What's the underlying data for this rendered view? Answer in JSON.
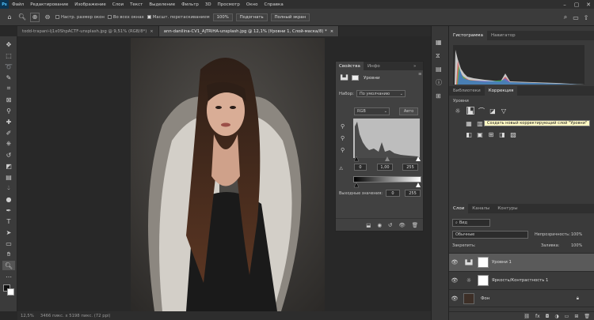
{
  "app": {
    "logo": "Ps"
  },
  "menu": [
    "Файл",
    "Редактирование",
    "Изображение",
    "Слои",
    "Текст",
    "Выделение",
    "Фильтр",
    "3D",
    "Просмотр",
    "Окно",
    "Справка"
  ],
  "options": {
    "resize_windows": "Настр. размер окон",
    "all_windows": "Во всех окнах",
    "scrubby_zoom": "Масшт. перетаскиванием",
    "zoom_value": "100%",
    "fit_button": "Подогнать",
    "fill_screen_button": "Полный экран"
  },
  "tabs": [
    {
      "label": "todd-trapani-Ij1x0ShpACTF-unsplash.jpg @ 9,51% (RGB/8*)",
      "close": "×"
    },
    {
      "label": "ann-danilina-CV1_AjTRIHA-unsplash.jpg @ 12,1% (Уровни 1, Слой-маска/8) *",
      "close": "×"
    }
  ],
  "status": {
    "zoom": "12,5%",
    "dimensions": "3466 пикс. x 5198 пикс. (72 ppi)"
  },
  "properties": {
    "tab_properties": "Свойства",
    "tab_info": "Инфо",
    "collapse": "»",
    "menu": "≡",
    "title": "Уровни",
    "preset_label": "Набор:",
    "preset_value": "По умолчанию",
    "channel": "RGB",
    "auto_button": "Авто",
    "input_black": "0",
    "input_gamma": "1,00",
    "input_white": "255",
    "output_label": "Выходные значения:",
    "output_black": "0",
    "output_white": "255"
  },
  "right_panel": {
    "histogram_tab": "Гистограмма",
    "navigator_tab": "Навигатор",
    "libraries_tab": "Библиотеки",
    "adjustments_tab": "Коррекция",
    "levels_label": "Уровни",
    "tooltip": "Создать новый корректирующий слой \"Уровни\"",
    "layers_tab": "Слои",
    "channels_tab": "Каналы",
    "paths_tab": "Контуры",
    "filter_kind": "Вид",
    "blend_mode": "Обычные",
    "opacity_label": "Непрозрачность:",
    "opacity_value": "100%",
    "lock_label": "Закрепить:",
    "fill_label": "Заливка:",
    "fill_value": "100%"
  },
  "layers": [
    {
      "name": "Уровни 1",
      "selected": true
    },
    {
      "name": "Яркость/Контрастность 1",
      "selected": false
    },
    {
      "name": "Фон",
      "selected": false
    }
  ],
  "icons": [
    "home-icon",
    "zoom-tool-icon",
    "zoom-in-icon",
    "zoom-out-icon",
    "move-tool-icon",
    "marquee-tool-icon",
    "lasso-tool-icon",
    "quick-selection-icon",
    "crop-tool-icon",
    "eyedropper-icon",
    "healing-brush-icon",
    "brush-tool-icon",
    "clone-stamp-icon",
    "history-brush-icon",
    "eraser-icon",
    "gradient-icon",
    "blur-icon",
    "dodge-icon",
    "pen-tool-icon",
    "text-tool-icon",
    "path-selection-icon",
    "rectangle-tool-icon",
    "hand-tool-icon",
    "zoom-icon",
    "eye-icon",
    "lock-icon",
    "trash-icon",
    "search-icon",
    "gear-icon"
  ],
  "colors": {
    "accent": "#2d8ceb",
    "panel": "#3a3a3a",
    "dark": "#282828",
    "tooltip_bg": "#fff9c4"
  }
}
